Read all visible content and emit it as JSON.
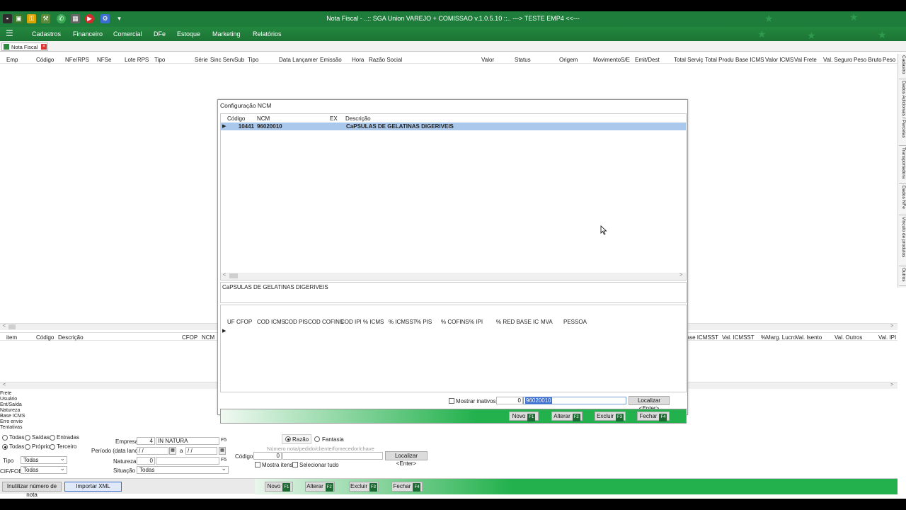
{
  "window": {
    "title": "Nota Fiscal - ..:: SGA Union VAREJO + COMISSAO v.1.0.5.10 ::.. ---> TESTE EMP4 <<---"
  },
  "menu": [
    "Cadastros",
    "Financeiro",
    "Comercial",
    "DFe",
    "Estoque",
    "Marketing",
    "Relatórios"
  ],
  "tab": {
    "label": "Nota Fiscal"
  },
  "main_grid": {
    "columns": [
      "Emp",
      "Código",
      "NFe/RPS",
      "NFSe",
      "Lote RPS",
      "Tipo",
      "Série",
      "Sinc Serv",
      "Sub",
      "Tipo",
      "Data Lançamento",
      "Emissão",
      "Hora",
      "Razão Social",
      "Valor",
      "Status",
      "Origem",
      "Movimento",
      "S/E",
      "Emit/Dest",
      "Total Serviço",
      "Total Produto",
      "Base ICMS",
      "Valor ICMS",
      "Val Frete",
      "Val. Seguro",
      "Peso Bruto",
      "Peso L"
    ]
  },
  "right_tabs": [
    "Cadastro",
    "Dados Adicionais / Parcelas",
    "Transportadora",
    "Dados NFe",
    "Vinculo de produtos",
    "Outros"
  ],
  "items_grid": {
    "columns_left": [
      "item",
      "Código",
      "Descrição",
      "CFOP",
      "NCM"
    ],
    "columns_right": [
      "Base ICMSST",
      "Val. ICMSST",
      "%Marg. Lucro",
      "Val. Isento",
      "Val. Outros",
      "Val. IPI"
    ]
  },
  "side_labels": [
    "Frete",
    "Usuário",
    "Ent/Saída",
    "Natureza",
    "Base ICMS",
    "Erro envio",
    "Tentativas"
  ],
  "filters": {
    "radios_row1": [
      "Todas",
      "Saídas",
      "Entradas"
    ],
    "radios_row2": [
      "Todas",
      "Próprio",
      "Terceiro"
    ],
    "tipo_label": "Tipo",
    "tipo_value": "Todas",
    "cif_label": "CIF/FOB",
    "cif_value": "Todas",
    "empresa_label": "Empresa",
    "empresa_code": "4",
    "empresa_name": "IN NATURA",
    "empresa_key": "F5",
    "periodo_label": "Período (data lanc)",
    "date1": "/ /",
    "date_sep": "a",
    "date2": "/ /",
    "natureza_label": "Natureza",
    "natureza_code": "0",
    "natureza_key": "F5",
    "situacao_label": "Situação",
    "situacao_value": "Todas",
    "razao": "Razão",
    "fantasia": "Fantasia",
    "search_hint": "Número nota/pedido/cliente/fornecedor/chave",
    "codigo_label": "Código",
    "codigo_value": "0",
    "localizar": "Localizar <Enter>",
    "mostra_itens": "Mostra itens",
    "selecionar_tudo": "Selecionar tudo"
  },
  "bottom": {
    "inutilizar": "Inutilizar número de nota",
    "importar": "Importar XML",
    "novo": "Novo",
    "novo_key": "F1",
    "alterar": "Alterar",
    "alterar_key": "F2",
    "excluir": "Excluir",
    "excluir_key": "F3",
    "fechar": "Fechar",
    "fechar_key": "F4"
  },
  "dialog": {
    "title": "Configuração NCM",
    "columns": [
      "Código",
      "NCM",
      "EX",
      "Descrição"
    ],
    "row": {
      "codigo": "10441",
      "ncm": "96020010",
      "ex": "",
      "descricao": "CaPSULAS DE GELATINAS DIGERIVEIS"
    },
    "description_text": "CaPSULAS DE GELATINAS DIGERIVEIS",
    "sub_columns": [
      "UF",
      "CFOP",
      "COD ICMS",
      "COD PIS",
      "COD COFINS",
      "COD IPI",
      "% ICMS",
      "% ICMSST",
      "% PIS",
      "% COFINS",
      "% IPI",
      "% RED BASE ICMS",
      "MVA",
      "PESSOA"
    ],
    "mostrar_inativos": "Mostrar inativos",
    "search_code": "0",
    "search_value": "96020010",
    "localizar": "Localizar <Enter>",
    "novo": "Novo",
    "novo_key": "F1",
    "alterar": "Alterar",
    "alterar_key": "F2",
    "excluir": "Excluir",
    "excluir_key": "F3",
    "fechar": "Fechar",
    "fechar_key": "F4"
  },
  "colors": {
    "green_dark": "#1e7d3b",
    "green_bar": "#22b14c",
    "selection": "#a9c8ec"
  }
}
